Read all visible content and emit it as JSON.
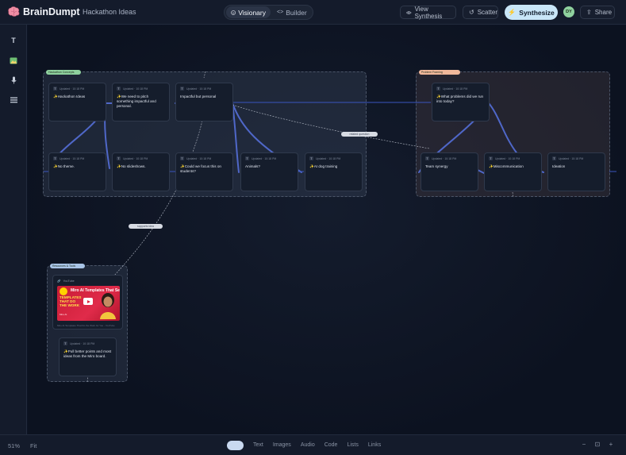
{
  "app": {
    "name": "BrainDumpt",
    "project_title": "Hackathon Ideas"
  },
  "header": {
    "modes": [
      {
        "label": "Visionary",
        "active": true,
        "icon": "smile-icon"
      },
      {
        "label": "Builder",
        "active": false,
        "icon": "code-icon"
      }
    ],
    "view_synthesis_label": "View Synthesis",
    "scatter_label": "Scatter",
    "synthesize_label": "Synthesize",
    "share_label": "Share",
    "avatar_initials": "DY",
    "accent_color": "#c9e6f8"
  },
  "toolbar": {
    "tools": [
      {
        "name": "text-tool",
        "icon": "T"
      },
      {
        "name": "image-tool",
        "icon": "image-icon"
      },
      {
        "name": "audio-tool",
        "icon": "microphone-icon"
      },
      {
        "name": "list-tool",
        "icon": "list-icon"
      }
    ]
  },
  "canvas": {
    "clusters": [
      {
        "tag": "Hackathon Concepts",
        "tag_color": "#8fd19e"
      },
      {
        "tag": "Problem Framing",
        "tag_color": "#f0b89a"
      },
      {
        "tag": "Resources & Tools",
        "tag_color": "#a8c4e6"
      }
    ],
    "cards": [
      {
        "badge": "T",
        "meta": "Updated · 10:18 PM",
        "text": "Hackathon Ideas",
        "has_icon": true
      },
      {
        "badge": "T",
        "meta": "Updated · 10:18 PM",
        "text": "We need to pitch something impactful and personal.",
        "has_icon": true
      },
      {
        "badge": "T",
        "meta": "Updated · 10:18 PM",
        "text": "Impactful but personal",
        "has_icon": false
      },
      {
        "badge": "T",
        "meta": "Updated · 10:18 PM",
        "text": "No theme.",
        "has_icon": true
      },
      {
        "badge": "T",
        "meta": "Updated · 10:18 PM",
        "text": "No slideshows.",
        "has_icon": true
      },
      {
        "badge": "T",
        "meta": "Updated · 10:18 PM",
        "text": "Could we focus this on students?",
        "has_icon": true
      },
      {
        "badge": "T",
        "meta": "Updated · 10:18 PM",
        "text": "Animals?",
        "has_icon": false
      },
      {
        "badge": "T",
        "meta": "Updated · 10:18 PM",
        "text": "AI dog training",
        "has_icon": true
      },
      {
        "badge": "T",
        "meta": "Updated · 10:18 PM",
        "text": "What problems did we run into today?",
        "has_icon": true
      },
      {
        "badge": "T",
        "meta": "Updated · 10:18 PM",
        "text": "Team synergy",
        "has_icon": false
      },
      {
        "badge": "T",
        "meta": "Updated · 10:18 PM",
        "text": "Miscommunication",
        "has_icon": true
      },
      {
        "badge": "T",
        "meta": "Updated · 10:18 PM",
        "text": "Ideation",
        "has_icon": false
      },
      {
        "badge": "T",
        "meta": "Updated · 10:18 PM",
        "text": "Pull better points and most ideas from the Miro board.",
        "has_icon": true
      }
    ],
    "edge_labels": [
      "related question",
      "supports idea"
    ],
    "video": {
      "source": "YouTube",
      "title": "Miro AI Templates That Se",
      "headline": "TEMPLATES THAT DO THE WORK",
      "sub": "Miro AI",
      "caption": "Miro AI Templates That Do the Work for You - YouTube"
    }
  },
  "footer": {
    "zoom": "51%",
    "fit_label": "Fit",
    "filters": [
      {
        "label": "All",
        "active": true
      },
      {
        "label": "Text",
        "active": false
      },
      {
        "label": "Images",
        "active": false
      },
      {
        "label": "Audio",
        "active": false
      },
      {
        "label": "Code",
        "active": false
      },
      {
        "label": "Lists",
        "active": false
      },
      {
        "label": "Links",
        "active": false
      }
    ],
    "zoom_out": "−",
    "zoom_fit": "⊡",
    "zoom_in": "+"
  }
}
